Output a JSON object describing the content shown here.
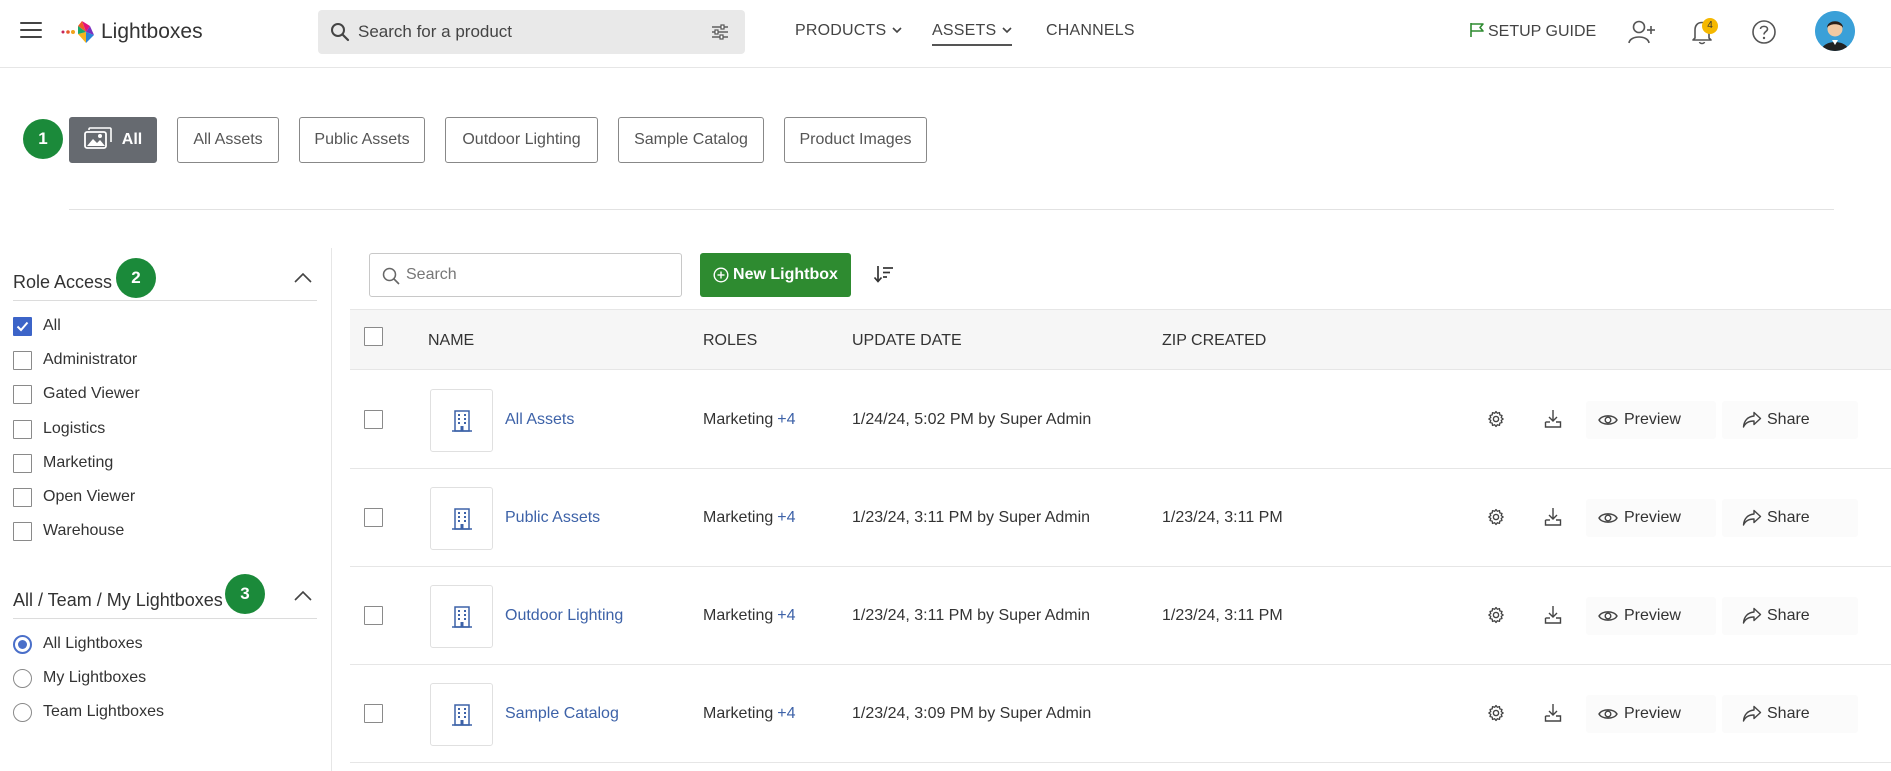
{
  "header": {
    "app_title": "Lightboxes",
    "search_placeholder": "Search for a product",
    "nav": [
      "PRODUCTS",
      "ASSETS",
      "CHANNELS"
    ],
    "active_nav": "ASSETS",
    "setup_guide": "SETUP GUIDE",
    "notification_count": "4",
    "colors": {
      "setup_flag": "#2e8b30",
      "badge": "#f5b800"
    }
  },
  "filters": {
    "step": "1",
    "chips": [
      "All",
      "All Assets",
      "Public Assets",
      "Outdoor Lighting",
      "Sample Catalog",
      "Product Images"
    ],
    "active_chip": "All",
    "colors": {
      "active_chip": "#666a70",
      "step_badge": "#1b8a3a"
    }
  },
  "sidebar": {
    "role_access": {
      "title": "Role Access",
      "step": "2",
      "options": [
        {
          "label": "All",
          "checked": true
        },
        {
          "label": "Administrator",
          "checked": false
        },
        {
          "label": "Gated Viewer",
          "checked": false
        },
        {
          "label": "Logistics",
          "checked": false
        },
        {
          "label": "Marketing",
          "checked": false
        },
        {
          "label": "Open Viewer",
          "checked": false
        },
        {
          "label": "Warehouse",
          "checked": false
        }
      ]
    },
    "lightbox_scope": {
      "title": "All / Team / My Lightboxes",
      "step": "3",
      "options": [
        {
          "label": "All Lightboxes",
          "selected": true
        },
        {
          "label": "My Lightboxes",
          "selected": false
        },
        {
          "label": "Team Lightboxes",
          "selected": false
        }
      ]
    }
  },
  "toolbar": {
    "search_placeholder": "Search",
    "new_lightbox": "New Lightbox",
    "colors": {
      "new_lightbox": "#2e8b30"
    }
  },
  "table": {
    "headers": {
      "name": "NAME",
      "roles": "ROLES",
      "update_date": "UPDATE DATE",
      "zip_created": "ZIP CREATED"
    },
    "rows": [
      {
        "name": "All Assets",
        "role": "Marketing",
        "more": "+4",
        "updated": "1/24/24, 5:02 PM by Super Admin",
        "zip": ""
      },
      {
        "name": "Public Assets",
        "role": "Marketing",
        "more": "+4",
        "updated": "1/23/24, 3:11 PM by Super Admin",
        "zip": "1/23/24, 3:11 PM"
      },
      {
        "name": "Outdoor Lighting",
        "role": "Marketing",
        "more": "+4",
        "updated": "1/23/24, 3:11 PM by Super Admin",
        "zip": "1/23/24, 3:11 PM"
      },
      {
        "name": "Sample Catalog",
        "role": "Marketing",
        "more": "+4",
        "updated": "1/23/24, 3:09 PM by Super Admin",
        "zip": ""
      }
    ],
    "actions": {
      "preview": "Preview",
      "share": "Share"
    },
    "icons": {
      "thumbnail": "building-icon",
      "settings": "gear-icon",
      "download": "download-icon"
    }
  }
}
